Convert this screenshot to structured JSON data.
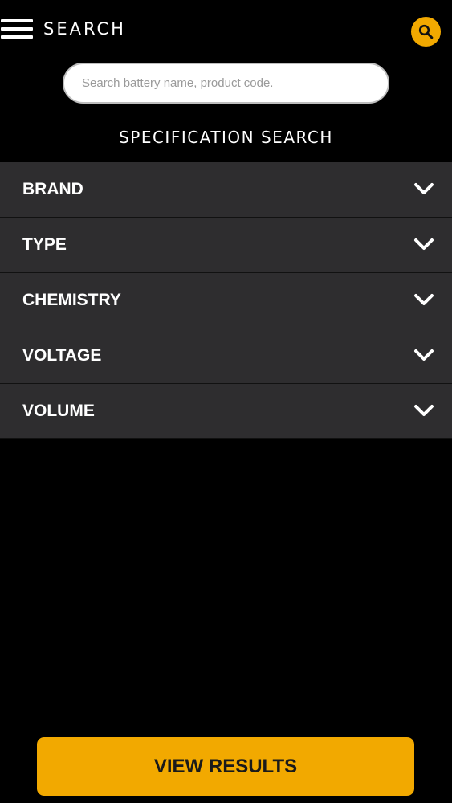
{
  "header": {
    "title": "SEARCH",
    "menu_icon": "hamburger-menu-icon",
    "search_icon": "magnifier-icon"
  },
  "search": {
    "placeholder": "Search battery name, product code.",
    "value": ""
  },
  "section_title": "SPECIFICATION SEARCH",
  "filters": [
    {
      "label": "BRAND"
    },
    {
      "label": "TYPE"
    },
    {
      "label": "CHEMISTRY"
    },
    {
      "label": "VOLTAGE"
    },
    {
      "label": "VOLUME"
    }
  ],
  "primary_button": {
    "label": "VIEW RESULTS"
  },
  "colors": {
    "accent": "#f2a900",
    "background": "#000000",
    "row_background": "#2e2d2f",
    "text": "#ffffff"
  }
}
